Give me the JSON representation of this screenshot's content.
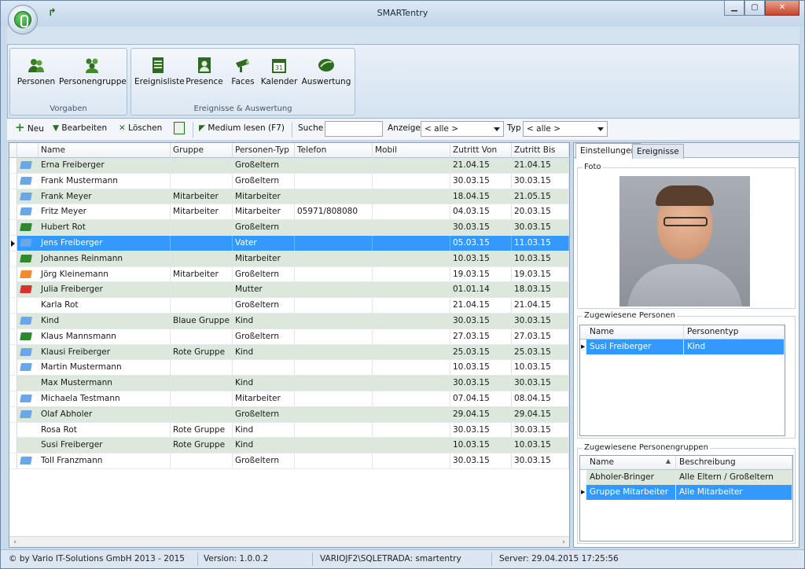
{
  "window": {
    "title": "SMARTentry"
  },
  "ribbon": {
    "groups": [
      {
        "label": "Vorgaben",
        "buttons": [
          {
            "label": "Personen",
            "icon": "persons-icon"
          },
          {
            "label": "Personengruppe",
            "icon": "person-group-icon"
          }
        ]
      },
      {
        "label": "Ereignisse & Auswertung",
        "buttons": [
          {
            "label": "Ereignisliste",
            "icon": "event-list-icon"
          },
          {
            "label": "Presence",
            "icon": "presence-icon"
          },
          {
            "label": "Faces",
            "icon": "camera-icon"
          },
          {
            "label": "Kalender",
            "icon": "calendar-icon"
          },
          {
            "label": "Auswertung",
            "icon": "chart-icon"
          }
        ]
      }
    ]
  },
  "toolbar": {
    "new_label": "Neu",
    "edit_label": "Bearbeiten",
    "delete_label": "Löschen",
    "read_medium_label": "Medium lesen (F7)",
    "search_label": "Suche",
    "search_value": "",
    "display_label": "Anzeige",
    "display_value": "< alle >",
    "type_label": "Typ",
    "type_value": "< alle >"
  },
  "grid": {
    "columns": [
      "Name",
      "Gruppe",
      "Personen-Typ",
      "Telefon",
      "Mobil",
      "Zutritt Von",
      "Zutritt Bis"
    ],
    "rows": [
      {
        "flag": "#6aa7e8",
        "name": "Erna Freiberger",
        "group": "",
        "type": "Großeltern",
        "phone": "",
        "mobile": "",
        "from": "21.04.15",
        "to": "21.04.15"
      },
      {
        "flag": "#6aa7e8",
        "name": "Frank Mustermann",
        "group": "",
        "type": "Großeltern",
        "phone": "",
        "mobile": "",
        "from": "30.03.15",
        "to": "30.03.15"
      },
      {
        "flag": "#6aa7e8",
        "name": "Frank Meyer",
        "group": "Mitarbeiter",
        "type": "Mitarbeiter",
        "phone": "",
        "mobile": "",
        "from": "18.04.15",
        "to": "21.05.15"
      },
      {
        "flag": "#6aa7e8",
        "name": "Fritz Meyer",
        "group": "Mitarbeiter",
        "type": "Mitarbeiter",
        "phone": "05971/808080",
        "mobile": "",
        "from": "04.03.15",
        "to": "20.03.15"
      },
      {
        "flag": "#2c8a2c",
        "name": "Hubert Rot",
        "group": "",
        "type": "Großeltern",
        "phone": "",
        "mobile": "",
        "from": "30.03.15",
        "to": "30.03.15"
      },
      {
        "flag": "#6aa7e8",
        "name": "Jens Freiberger",
        "group": "",
        "type": "Vater",
        "phone": "",
        "mobile": "",
        "from": "05.03.15",
        "to": "11.03.15"
      },
      {
        "flag": "#2c8a2c",
        "name": "Johannes Reinmann",
        "group": "",
        "type": "Mitarbeiter",
        "phone": "",
        "mobile": "",
        "from": "10.03.15",
        "to": "10.03.15"
      },
      {
        "flag": "#f08a2a",
        "name": "Jörg Kleinemann",
        "group": "Mitarbeiter",
        "type": "Großeltern",
        "phone": "",
        "mobile": "",
        "from": "19.03.15",
        "to": "19.03.15"
      },
      {
        "flag": "#d8322a",
        "name": "Julia Freiberger",
        "group": "",
        "type": "Mutter",
        "phone": "",
        "mobile": "",
        "from": "01.01.14",
        "to": "18.03.15"
      },
      {
        "flag": "",
        "name": "Karla Rot",
        "group": "",
        "type": "Großeltern",
        "phone": "",
        "mobile": "",
        "from": "21.04.15",
        "to": "21.04.15"
      },
      {
        "flag": "#6aa7e8",
        "name": "Kind",
        "group": "Blaue Gruppe",
        "type": "Kind",
        "phone": "",
        "mobile": "",
        "from": "30.03.15",
        "to": "30.03.15"
      },
      {
        "flag": "#2c8a2c",
        "name": "Klaus Mannsmann",
        "group": "",
        "type": "Großeltern",
        "phone": "",
        "mobile": "",
        "from": "27.03.15",
        "to": "27.03.15"
      },
      {
        "flag": "#6aa7e8",
        "name": "Klausi Freiberger",
        "group": "Rote Gruppe",
        "type": "Kind",
        "phone": "",
        "mobile": "",
        "from": "25.03.15",
        "to": "25.03.15"
      },
      {
        "flag": "#6aa7e8",
        "name": "Martin Mustermann",
        "group": "",
        "type": "",
        "phone": "",
        "mobile": "",
        "from": "10.03.15",
        "to": "10.03.15"
      },
      {
        "flag": "",
        "name": "Max Mustermann",
        "group": "",
        "type": "Kind",
        "phone": "",
        "mobile": "",
        "from": "30.03.15",
        "to": "30.03.15"
      },
      {
        "flag": "#6aa7e8",
        "name": "Michaela Testmann",
        "group": "",
        "type": "Mitarbeiter",
        "phone": "",
        "mobile": "",
        "from": "07.04.15",
        "to": "08.04.15"
      },
      {
        "flag": "#6aa7e8",
        "name": "Olaf Abholer",
        "group": "",
        "type": "Großeltern",
        "phone": "",
        "mobile": "",
        "from": "29.04.15",
        "to": "29.04.15"
      },
      {
        "flag": "",
        "name": "Rosa Rot",
        "group": "Rote Gruppe",
        "type": "Kind",
        "phone": "",
        "mobile": "",
        "from": "30.03.15",
        "to": "30.03.15"
      },
      {
        "flag": "",
        "name": "Susi Freiberger",
        "group": "Rote Gruppe",
        "type": "Kind",
        "phone": "",
        "mobile": "",
        "from": "10.03.15",
        "to": "10.03.15"
      },
      {
        "flag": "#6aa7e8",
        "name": "Toll Franzmann",
        "group": "",
        "type": "Großeltern",
        "phone": "",
        "mobile": "",
        "from": "30.03.15",
        "to": "30.03.15"
      }
    ],
    "selected_index": 5
  },
  "right_panel": {
    "tabs": [
      "Einstellungen",
      "Ereignisse"
    ],
    "photo_label": "Foto",
    "assigned_persons": {
      "label": "Zugewiesene Personen",
      "columns": [
        "Name",
        "Personentyp"
      ],
      "rows": [
        {
          "name": "Susi Freiberger",
          "type": "Kind"
        }
      ]
    },
    "assigned_groups": {
      "label": "Zugewiesene Personengruppen",
      "columns": [
        "Name",
        "Beschreibung"
      ],
      "rows": [
        {
          "name": "Abholer-Bringer",
          "desc": "Alle Eltern / Großeltern"
        },
        {
          "name": "Gruppe Mitarbeiter",
          "desc": "Alle Mitarbeiter"
        }
      ]
    }
  },
  "status": {
    "copyright": "© by Vario IT-Solutions GmbH 2013 - 2015",
    "version": "Version: 1.0.0.2",
    "db": "VARIOJF2\\SQLETRADA: smartentry",
    "server": "Server: 29.04.2015 17:25:56"
  },
  "colors": {
    "selection": "#3399ff",
    "row_alt": "#dce8dc",
    "accent_green": "#2c8a2c"
  }
}
